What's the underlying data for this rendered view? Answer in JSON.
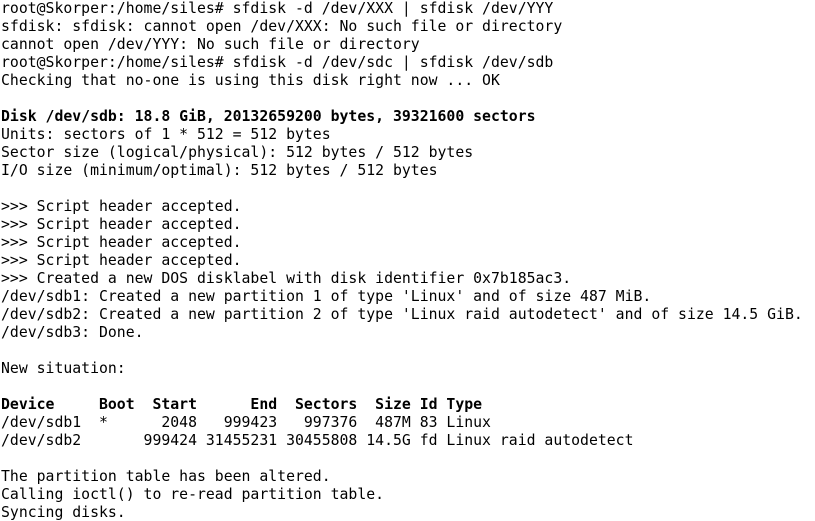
{
  "terminal": {
    "background_color": "#ffffff",
    "text_color": "#000000",
    "lines": [
      {
        "text": "root@Skorper:/home/siles# sfdisk -d /dev/XXX | sfdisk /dev/YYY",
        "bold": false
      },
      {
        "text": "sfdisk: sfdisk: cannot open /dev/XXX: No such file or directory",
        "bold": false
      },
      {
        "text": "cannot open /dev/YYY: No such file or directory",
        "bold": false
      },
      {
        "text": "root@Skorper:/home/siles# sfdisk -d /dev/sdc | sfdisk /dev/sdb",
        "bold": false
      },
      {
        "text": "Checking that no-one is using this disk right now ... OK",
        "bold": false
      },
      {
        "text": "",
        "bold": false
      },
      {
        "text": "Disk /dev/sdb: 18.8 GiB, 20132659200 bytes, 39321600 sectors",
        "bold": true
      },
      {
        "text": "Units: sectors of 1 * 512 = 512 bytes",
        "bold": false
      },
      {
        "text": "Sector size (logical/physical): 512 bytes / 512 bytes",
        "bold": false
      },
      {
        "text": "I/O size (minimum/optimal): 512 bytes / 512 bytes",
        "bold": false
      },
      {
        "text": "",
        "bold": false
      },
      {
        "text": ">>> Script header accepted.",
        "bold": false
      },
      {
        "text": ">>> Script header accepted.",
        "bold": false
      },
      {
        "text": ">>> Script header accepted.",
        "bold": false
      },
      {
        "text": ">>> Script header accepted.",
        "bold": false
      },
      {
        "text": ">>> Created a new DOS disklabel with disk identifier 0x7b185ac3.",
        "bold": false
      },
      {
        "text": "/dev/sdb1: Created a new partition 1 of type 'Linux' and of size 487 MiB.",
        "bold": false
      },
      {
        "text": "/dev/sdb2: Created a new partition 2 of type 'Linux raid autodetect' and of size 14.5 GiB.",
        "bold": false
      },
      {
        "text": "/dev/sdb3: Done.",
        "bold": false
      },
      {
        "text": "",
        "bold": false
      },
      {
        "text": "New situation:",
        "bold": false
      },
      {
        "text": "",
        "bold": false
      },
      {
        "text": "Device     Boot  Start      End  Sectors  Size Id Type",
        "bold": true
      },
      {
        "text": "/dev/sdb1  *      2048   999423   997376  487M 83 Linux",
        "bold": false
      },
      {
        "text": "/dev/sdb2       999424 31455231 30455808 14.5G fd Linux raid autodetect",
        "bold": false
      },
      {
        "text": "",
        "bold": false
      },
      {
        "text": "The partition table has been altered.",
        "bold": false
      },
      {
        "text": "Calling ioctl() to re-read partition table.",
        "bold": false
      },
      {
        "text": "Syncing disks.",
        "bold": false
      }
    ]
  }
}
